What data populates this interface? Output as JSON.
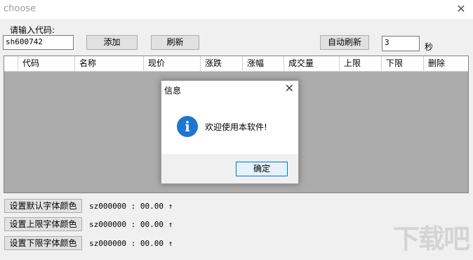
{
  "window": {
    "title": "choose"
  },
  "top": {
    "code_label": "请输入代码:",
    "code_value": "sh600742",
    "add_label": "添加",
    "refresh_label": "刷新",
    "auto_refresh_label": "自动刷新",
    "interval_value": "3",
    "seconds_label": "秒"
  },
  "grid": {
    "columns": [
      "代码",
      "名称",
      "现价",
      "涨跌",
      "涨幅",
      "成交量",
      "上限",
      "下限",
      "删除"
    ]
  },
  "dialog": {
    "title": "信息",
    "message": "欢迎使用本软件!",
    "ok_label": "确定",
    "icon_glyph": "i"
  },
  "bottom": {
    "rows": [
      {
        "button": "设置默认字体颜色",
        "text": "sz000000 : 00.00 ↑"
      },
      {
        "button": "设置上限字体颜色",
        "text": "sz000000 : 00.00 ↑"
      },
      {
        "button": "设置下限字体颜色",
        "text": "sz000000 : 00.00 ↑"
      }
    ]
  },
  "watermark": "下载吧"
}
